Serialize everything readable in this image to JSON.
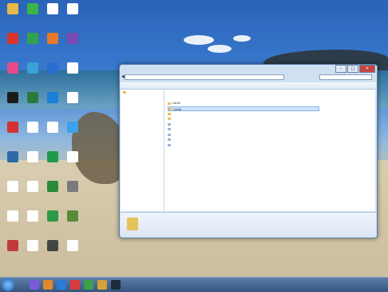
{
  "desktop": {
    "icons": [
      {
        "label": "",
        "color": "#e9b84a"
      },
      {
        "label": "",
        "color": "#3bb44a"
      },
      {
        "label": "",
        "color": "#ffffff"
      },
      {
        "label": "",
        "color": "#ffffff"
      },
      {
        "label": "",
        "color": "#d9342b"
      },
      {
        "label": "",
        "color": "#33a24f"
      },
      {
        "label": "",
        "color": "#e8792a"
      },
      {
        "label": "",
        "color": "#7b4bb3"
      },
      {
        "label": "",
        "color": "#e84a8a"
      },
      {
        "label": "",
        "color": "#3aa1d8"
      },
      {
        "label": "",
        "color": "#2a6dd0"
      },
      {
        "label": "",
        "color": "#ffffff"
      },
      {
        "label": "",
        "color": "#1c1c1c"
      },
      {
        "label": "",
        "color": "#2c7a3a"
      },
      {
        "label": "",
        "color": "#1a80d8"
      },
      {
        "label": "",
        "color": "#ffffff"
      },
      {
        "label": "",
        "color": "#d63030"
      },
      {
        "label": "",
        "color": "#ffffff"
      },
      {
        "label": "",
        "color": "#ffffff"
      },
      {
        "label": "",
        "color": "#3da0e8"
      },
      {
        "label": "",
        "color": "#2b6aa6"
      },
      {
        "label": "",
        "color": "#ffffff"
      },
      {
        "label": "",
        "color": "#1e9a4a"
      },
      {
        "label": "",
        "color": "#ffffff"
      },
      {
        "label": "",
        "color": "#ffffff"
      },
      {
        "label": "",
        "color": "#ffffff"
      },
      {
        "label": "",
        "color": "#2a8a3a"
      },
      {
        "label": "",
        "color": "#7a7a7a"
      },
      {
        "label": "",
        "color": "#ffffff"
      },
      {
        "label": "",
        "color": "#ffffff"
      },
      {
        "label": "",
        "color": "#2d9a4a"
      },
      {
        "label": "",
        "color": "#5a8a3a"
      },
      {
        "label": "",
        "color": "#c03a3a"
      },
      {
        "label": "",
        "color": "#ffffff"
      },
      {
        "label": "",
        "color": "#444444"
      },
      {
        "label": "",
        "color": "#ffffff"
      }
    ]
  },
  "window": {
    "address": "",
    "search_placeholder": "",
    "nav_tree": [
      "",
      "",
      "",
      "",
      "",
      "",
      "",
      "",
      "",
      "",
      "",
      "",
      "",
      "",
      "",
      "",
      "",
      "",
      "",
      "",
      "",
      "",
      "",
      ""
    ],
    "files": [
      {
        "name": "Cache",
        "date": "",
        "type": "",
        "size": "",
        "kind": "folder",
        "selected": false
      },
      {
        "name": "Config",
        "date": "",
        "type": "",
        "size": "",
        "kind": "folder",
        "selected": true
      },
      {
        "name": "",
        "date": "",
        "type": "",
        "size": "",
        "kind": "folder",
        "selected": false
      },
      {
        "name": "",
        "date": "",
        "type": "",
        "size": "",
        "kind": "folder",
        "selected": false
      },
      {
        "name": "",
        "date": "",
        "type": "",
        "size": "",
        "kind": "file",
        "selected": false
      },
      {
        "name": "",
        "date": "",
        "type": "",
        "size": "",
        "kind": "file",
        "selected": false
      },
      {
        "name": "",
        "date": "",
        "type": "",
        "size": "",
        "kind": "file",
        "selected": false
      },
      {
        "name": "",
        "date": "",
        "type": "",
        "size": "",
        "kind": "file",
        "selected": false
      },
      {
        "name": "",
        "date": "",
        "type": "",
        "size": "",
        "kind": "file",
        "selected": false
      }
    ],
    "status": {
      "line1": "",
      "line2": ""
    },
    "controls": {
      "minimize": "–",
      "maximize": "□",
      "close": "✕"
    }
  },
  "taskbar": {
    "apps": [
      {
        "name": "start-orb",
        "color": "#1a5fb4"
      },
      {
        "name": "app-1",
        "color": "#7a5ad8"
      },
      {
        "name": "app-2",
        "color": "#e08a2a"
      },
      {
        "name": "app-3",
        "color": "#2b7bd8"
      },
      {
        "name": "app-4",
        "color": "#d93a3a"
      },
      {
        "name": "app-5",
        "color": "#3aa14a"
      },
      {
        "name": "app-6",
        "color": "#d8a13a"
      },
      {
        "name": "app-7",
        "color": "#1b2b3a"
      }
    ],
    "clock": ""
  }
}
